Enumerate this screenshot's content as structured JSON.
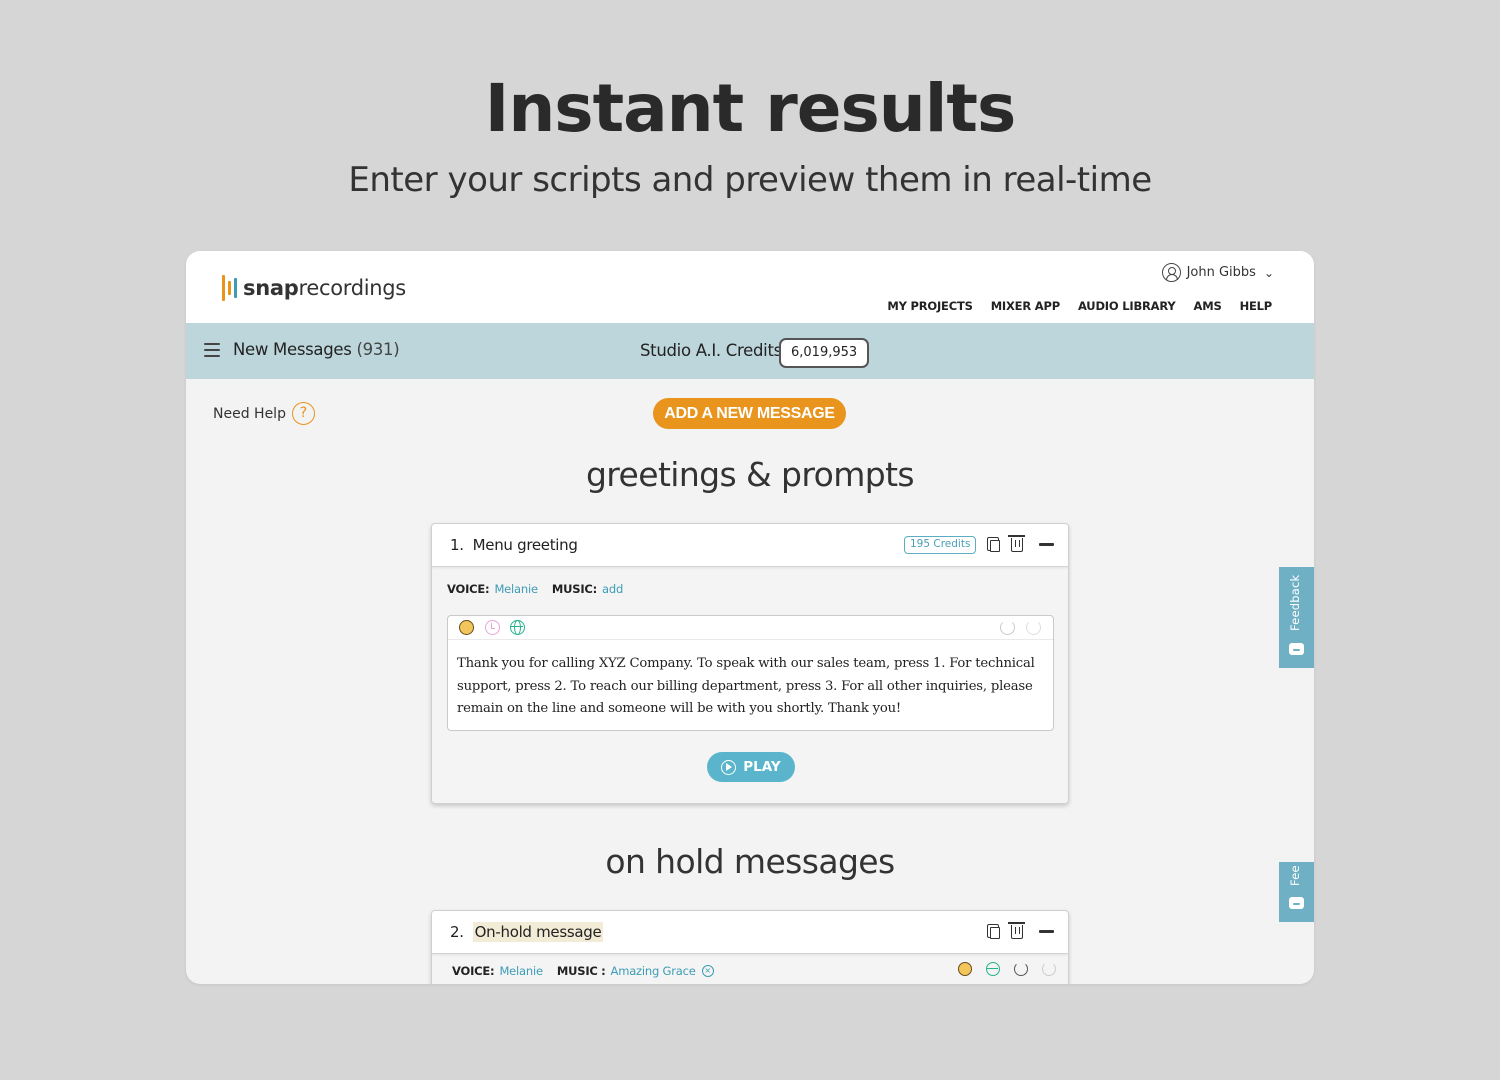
{
  "hero": {
    "title": "Instant results",
    "subtitle": "Enter your scripts and preview them in real-time"
  },
  "brand": {
    "name_bold": "snap",
    "name_rest": "recordings",
    "bar_colors": [
      "#e8941d",
      "#3d9cb6"
    ]
  },
  "user": {
    "name": "John Gibbs"
  },
  "nav": {
    "items": [
      "MY PROJECTS",
      "MIXER APP",
      "AUDIO LIBRARY",
      "AMS",
      "HELP"
    ]
  },
  "subbar": {
    "title": "New Messages",
    "count": "(931)",
    "credits_label": "Studio A.I. Credits:",
    "credits_value": "6,019,953"
  },
  "help": {
    "label": "Need Help",
    "icon": "?"
  },
  "add_button": "ADD A NEW MESSAGE",
  "sections": [
    {
      "title": "greetings & prompts",
      "card": {
        "number": "1.",
        "name": "Menu greeting",
        "credits": "195 Credits",
        "voice_label": "VOICE:",
        "voice": "Melanie",
        "music_label": "MUSIC:",
        "music": "add",
        "script": "Thank you for calling XYZ Company. To speak with our sales team, press 1. For technical support, press 2. To reach our billing department, press 3. For all other inquiries, please remain on the line and someone will be with you shortly. Thank you!",
        "play_label": "PLAY"
      }
    },
    {
      "title": "on hold messages",
      "card": {
        "number": "2.",
        "name": "On-hold message",
        "voice_label": "VOICE:",
        "voice": "Melanie",
        "music_label": "MUSIC",
        "music_sep": ":",
        "music": "Amazing Grace"
      }
    }
  ],
  "feedback": {
    "label": "Feedback",
    "label_short": "Fee"
  },
  "colors": {
    "accent_orange": "#e8941d",
    "accent_teal": "#3d9cb6",
    "subbar_bg": "#bdd6db",
    "play_bg": "#5ab5cc"
  }
}
